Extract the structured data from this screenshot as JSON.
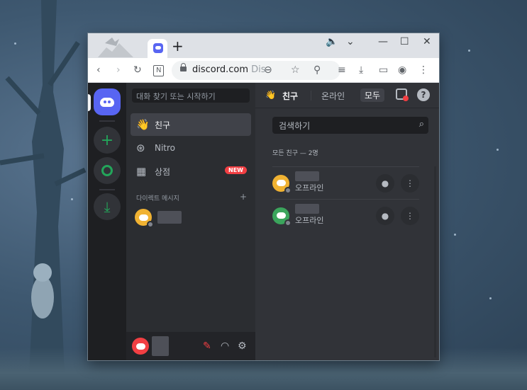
{
  "browser": {
    "url_domain": "discord.com",
    "url_dim": "Dis",
    "tab_add": "+",
    "controls": {
      "minimize": "—",
      "maximize": "☐",
      "close": "✕"
    }
  },
  "channel_panel": {
    "search_placeholder": "대화 찾기 또는 시작하기",
    "nav": [
      {
        "label": "친구",
        "icon": "friends-icon"
      },
      {
        "label": "Nitro",
        "icon": "nitro-icon"
      },
      {
        "label": "상점",
        "icon": "shop-icon",
        "badge": "NEW"
      }
    ],
    "dm_header": "다이렉트 메시지",
    "dm_add": "+"
  },
  "main": {
    "header": {
      "title": "친구",
      "tabs": [
        {
          "label": "온라인"
        },
        {
          "label": "모두",
          "active": true
        }
      ]
    },
    "search_placeholder": "검색하기",
    "count_label": "모든 친구 — 2명",
    "friends": [
      {
        "status": "오프라인",
        "avatar_color": "#f0b232"
      },
      {
        "status": "오프라인",
        "avatar_color": "#3ba55c"
      }
    ]
  },
  "colors": {
    "blurple": "#5865f2",
    "danger": "#f23f43",
    "green": "#23a55a"
  }
}
